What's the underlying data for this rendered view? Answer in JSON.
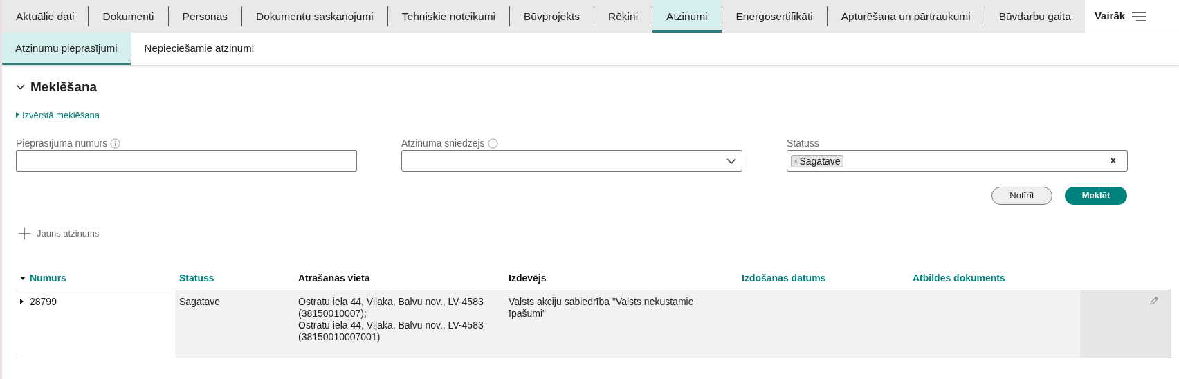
{
  "tabs": [
    {
      "label": "Aktuālie dati",
      "selected": false
    },
    {
      "label": "Dokumenti",
      "selected": false
    },
    {
      "label": "Personas",
      "selected": false
    },
    {
      "label": "Dokumentu saskaņojumi",
      "selected": false
    },
    {
      "label": "Tehniskie noteikumi",
      "selected": false
    },
    {
      "label": "Būvprojekts",
      "selected": false
    },
    {
      "label": "Rēķini",
      "selected": false
    },
    {
      "label": "Atzinumi",
      "selected": true
    },
    {
      "label": "Energosertifikāti",
      "selected": false
    },
    {
      "label": "Apturēšana un pārtraukumi",
      "selected": false
    },
    {
      "label": "Būvdarbu gaita",
      "selected": false
    }
  ],
  "more_menu": {
    "label": "Vairāk"
  },
  "subtabs": [
    {
      "label": "Atzinumu pieprasījumi",
      "selected": true
    },
    {
      "label": "Nepieciešamie atzinumi",
      "selected": false
    }
  ],
  "search": {
    "title": "Meklēšana",
    "expanded": true,
    "advanced_link": "Izvērstā meklēšana",
    "fields": [
      {
        "kind": "text",
        "label": "Pieprasījuma numurs",
        "info": true
      },
      {
        "kind": "select",
        "label": "Atzinuma sniedzējs",
        "info": true
      },
      {
        "kind": "tags",
        "label": "Statuss",
        "info": false,
        "tags": [
          {
            "label": "Sagatave",
            "remove": "×"
          }
        ],
        "clear": "×"
      }
    ],
    "buttons": [
      {
        "label": "Notīrīt",
        "kind": "secondary"
      },
      {
        "label": "Meklēt",
        "kind": "primary"
      }
    ]
  },
  "new_button": "Jauns atzinums",
  "table": {
    "columns": [
      {
        "label": "Numurs",
        "sortable": true,
        "sorted": true
      },
      {
        "label": "Statuss",
        "sortable": true,
        "sorted": false
      },
      {
        "label": "Atrašanās vieta",
        "sortable": false,
        "sorted": false
      },
      {
        "label": "Izdevējs",
        "sortable": false,
        "sorted": false
      },
      {
        "label": "Izdošanas datums",
        "sortable": true,
        "sorted": false
      },
      {
        "label": "Atbildes dokuments",
        "sortable": true,
        "sorted": false
      }
    ],
    "rows": [
      {
        "expanded": false,
        "cells": [
          "28799",
          "Sagatave",
          "Ostratu iela 44, Viļaka, Balvu nov., LV-4583 (38150010007);\nOstratu iela 44, Viļaka, Balvu nov., LV-4583 (38150010007001)",
          "Valsts akciju sabiedrība \"Valsts nekustamie īpašumi\""
        ]
      }
    ]
  }
}
